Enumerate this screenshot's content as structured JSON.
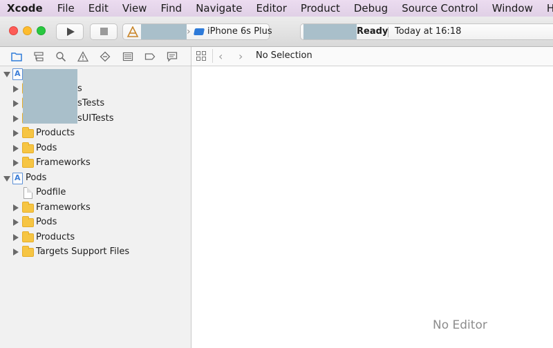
{
  "menubar": {
    "items": [
      "Xcode",
      "File",
      "Edit",
      "View",
      "Find",
      "Navigate",
      "Editor",
      "Product",
      "Debug",
      "Source Control",
      "Window",
      "Help"
    ]
  },
  "toolbar": {
    "run_icon": "play-icon",
    "stop_icon": "stop-icon",
    "scheme_icon": "app-target-icon",
    "device": "iPhone 6s Plus",
    "status": "Ready",
    "status_time": "Today at 16:18"
  },
  "navigator_tabs": [
    "folder-icon",
    "hierarchy-icon",
    "search-icon",
    "warning-icon",
    "diamond-icon",
    "list-icon",
    "tag-icon",
    "comment-icon"
  ],
  "tree": [
    {
      "label": "",
      "indent": 0,
      "icon": "project",
      "open": true
    },
    {
      "label": "s",
      "indent": 1,
      "icon": "folder"
    },
    {
      "label": "sTests",
      "indent": 1,
      "icon": "folder"
    },
    {
      "label": "sUITests",
      "indent": 1,
      "icon": "folder"
    },
    {
      "label": "Products",
      "indent": 1,
      "icon": "folder"
    },
    {
      "label": "Pods",
      "indent": 1,
      "icon": "folder"
    },
    {
      "label": "Frameworks",
      "indent": 1,
      "icon": "folder"
    },
    {
      "label": "Pods",
      "indent": 0,
      "icon": "project",
      "open": true
    },
    {
      "label": "Podfile",
      "indent": 1,
      "icon": "file",
      "leaf": true
    },
    {
      "label": "Frameworks",
      "indent": 1,
      "icon": "folder"
    },
    {
      "label": "Pods",
      "indent": 1,
      "icon": "folder"
    },
    {
      "label": "Products",
      "indent": 1,
      "icon": "folder"
    },
    {
      "label": "Targets Support Files",
      "indent": 1,
      "icon": "folder"
    }
  ],
  "jumpbar": {
    "selection": "No Selection"
  },
  "editor": {
    "empty_text": "No Editor"
  },
  "colors": {
    "menubar": "#e6d6ea",
    "folder": "#f6c543",
    "accent": "#2f7bd9",
    "redaction": "#a9bfca"
  }
}
